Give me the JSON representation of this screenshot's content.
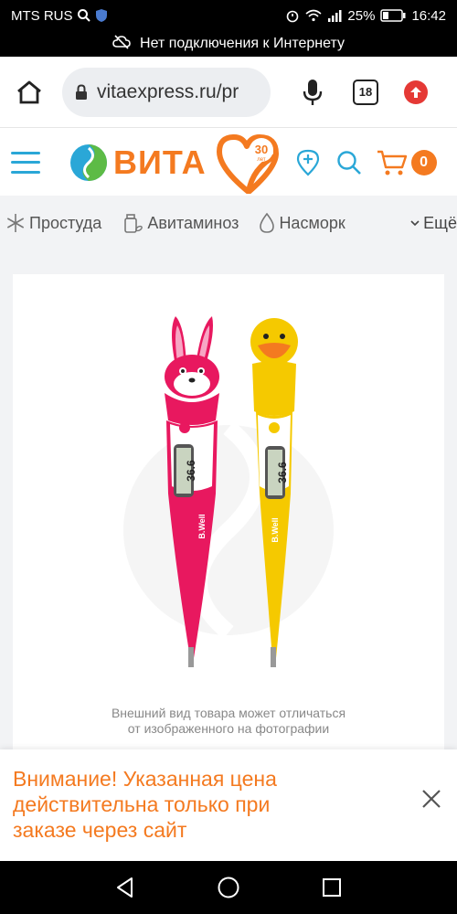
{
  "status_bar": {
    "carrier": "MTS RUS",
    "battery": "25%",
    "time": "16:42"
  },
  "offline_banner": {
    "text": "Нет подключения к Интернету",
    "icon": "cloud-off-icon"
  },
  "browser": {
    "url": "vitaexpress.ru/pr",
    "tab_count": "18"
  },
  "site_header": {
    "logo_text": "ВИТА",
    "logo_badge": "30",
    "logo_badge_sub": "лет",
    "cart_count": "0"
  },
  "categories": [
    {
      "label": "Простуда",
      "icon": "snowflake-icon"
    },
    {
      "label": "Авитаминоз",
      "icon": "pill-bottle-icon"
    },
    {
      "label": "Насморк",
      "icon": "drop-icon"
    }
  ],
  "more_label": "Ещё",
  "product": {
    "image_caption_line1": "Внешний вид товара может отличаться",
    "image_caption_line2": "от изображенного на фотографии",
    "thermo_reading": "36.6",
    "brand": "B.Well"
  },
  "notice": {
    "text_line1": "Внимание! Указанная цена",
    "text_line2": "действительна только при",
    "text_line3": "заказе через сайт"
  },
  "colors": {
    "accent_orange": "#f47a20",
    "accent_blue": "#2aa7d7",
    "pink": "#e8185f",
    "yellow": "#f5c900"
  }
}
